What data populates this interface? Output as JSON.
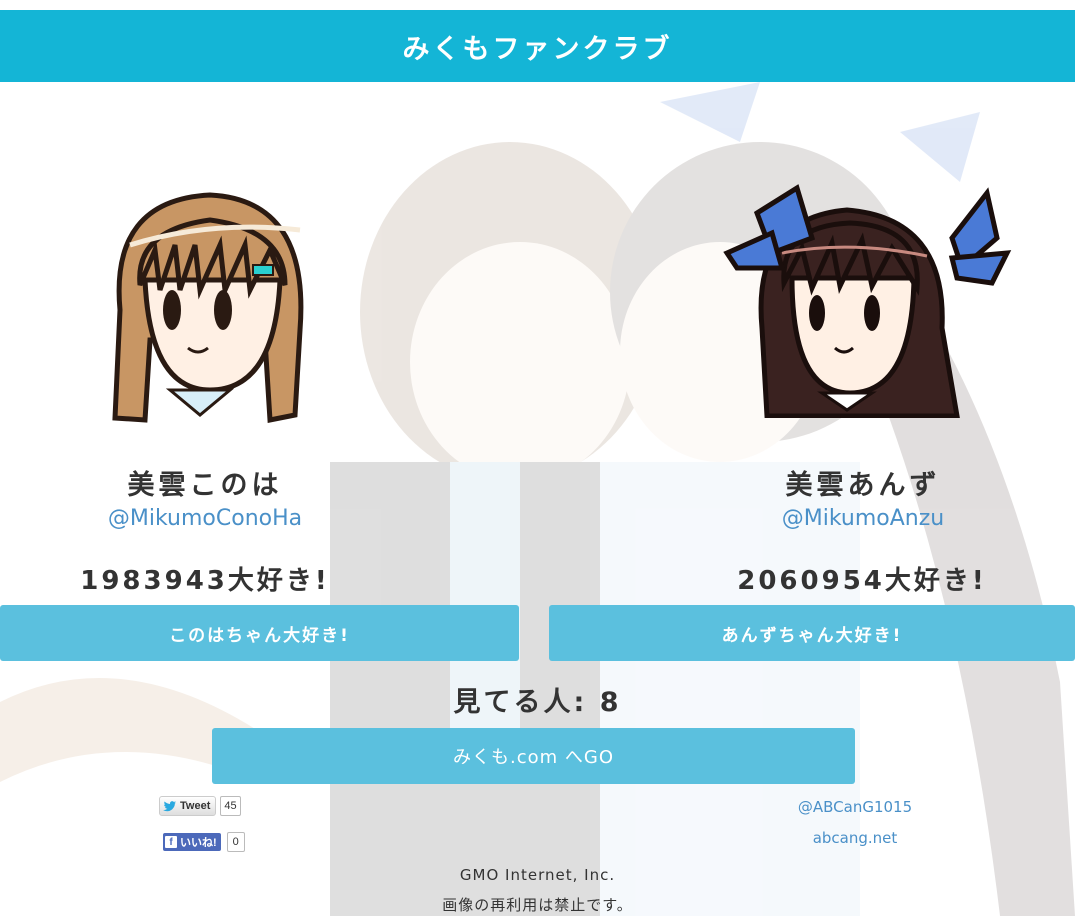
{
  "header": {
    "title": "みくもファンクラブ"
  },
  "left": {
    "name": "美雲このは",
    "handle": "@MikumoConoHa",
    "count": "1983943大好き!",
    "button": "このはちゃん大好き!"
  },
  "right": {
    "name": "美雲あんず",
    "handle": "@MikumoAnzu",
    "count": "2060954大好き!",
    "button": "あんずちゃん大好き!"
  },
  "watchers": "見てる人: 8",
  "go_button": "みくも.com へGO",
  "social": {
    "tweet_label": "Tweet",
    "tweet_count": "45",
    "like_label": "いいね!",
    "like_count": "0"
  },
  "credits": {
    "artist_handle": "@ABCanG1015",
    "artist_site": "abcang.net",
    "company": "GMO Internet, Inc.",
    "notice": "画像の再利用は禁止です。"
  },
  "colors": {
    "header": "#14b5d6",
    "button": "#5bc0de",
    "link": "#4a90c8"
  },
  "icons": [
    "twitter-bird-icon",
    "facebook-icon"
  ]
}
